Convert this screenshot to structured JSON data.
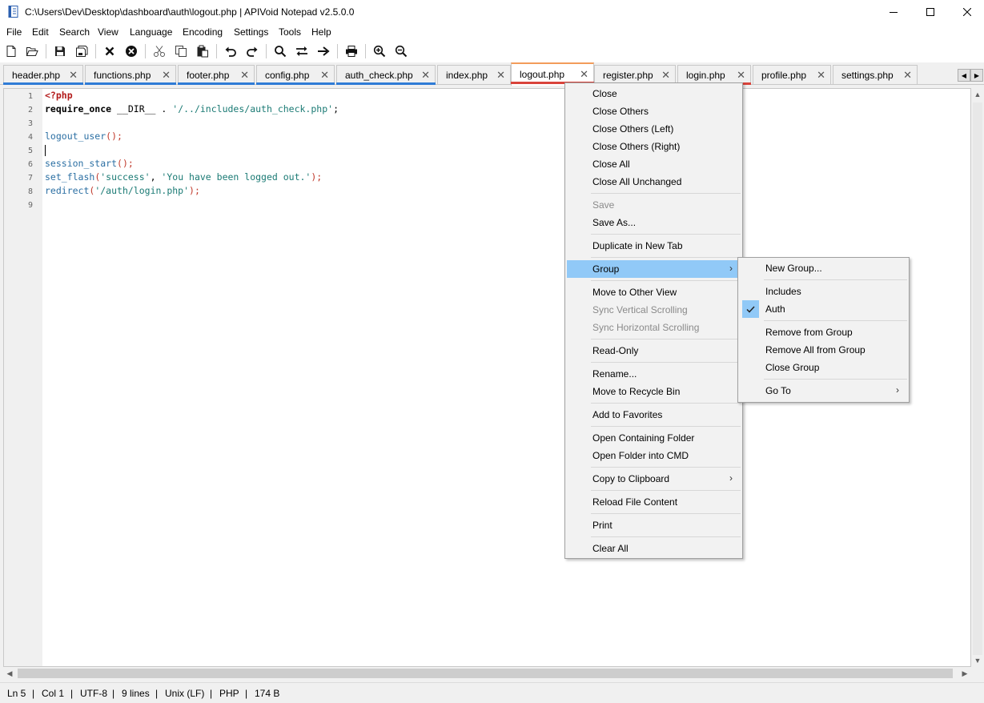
{
  "window": {
    "title": "C:\\Users\\Dev\\Desktop\\dashboard\\auth\\logout.php | APIVoid Notepad v2.5.0.0"
  },
  "menu": [
    "File",
    "Edit",
    "Search",
    "View",
    "Language",
    "Encoding",
    "Settings",
    "Tools",
    "Help"
  ],
  "toolbar_icons": [
    "new-file-icon",
    "open-file-icon",
    "save-icon",
    "save-all-icon",
    "close-icon",
    "close-all-icon",
    "cut-icon",
    "copy-icon",
    "paste-icon",
    "undo-icon",
    "redo-icon",
    "find-icon",
    "replace-icon",
    "goto-icon",
    "print-icon",
    "zoom-in-icon",
    "zoom-out-icon"
  ],
  "tabs": [
    {
      "label": "header.php",
      "color": "#2f7bd6"
    },
    {
      "label": "functions.php",
      "color": "#2f7bd6"
    },
    {
      "label": "footer.php",
      "color": "#2f7bd6"
    },
    {
      "label": "config.php",
      "color": "#2f7bd6"
    },
    {
      "label": "auth_check.php",
      "color": "#2f7bd6"
    },
    {
      "label": "index.php",
      "color": ""
    },
    {
      "label": "logout.php",
      "color": "#d9433b",
      "active": true
    },
    {
      "label": "register.php",
      "color": "#d9433b"
    },
    {
      "label": "login.php",
      "color": "#d9433b"
    },
    {
      "label": "profile.php",
      "color": ""
    },
    {
      "label": "settings.php",
      "color": ""
    }
  ],
  "editor": {
    "line_numbers": [
      "1",
      "2",
      "3",
      "4",
      "5",
      "6",
      "7",
      "8",
      "9"
    ],
    "code": {
      "l1": "<?php",
      "l2_kw": "require_once",
      "l2_mid": " __DIR__ . ",
      "l2_str": "'/../includes/auth_check.php'",
      "l2_end": ";",
      "l4_fn": "logout_user",
      "l4_end": "();",
      "l6_fn": "session_start",
      "l6_end": "();",
      "l7_fn": "set_flash",
      "l7_p1": "(",
      "l7_s1": "'success'",
      "l7_p2": ", ",
      "l7_s2": "'You have been logged out.'",
      "l7_end": ");",
      "l8_fn": "redirect",
      "l8_p1": "(",
      "l8_s1": "'/auth/login.php'",
      "l8_end": ");"
    }
  },
  "context_menu": {
    "items": [
      {
        "label": "Close",
        "enabled": true
      },
      {
        "label": "Close Others",
        "enabled": true
      },
      {
        "label": "Close Others (Left)",
        "enabled": true
      },
      {
        "label": "Close Others (Right)",
        "enabled": true
      },
      {
        "label": "Close All",
        "enabled": true
      },
      {
        "label": "Close All Unchanged",
        "enabled": true
      },
      {
        "label": "Save",
        "enabled": false
      },
      {
        "label": "Save As...",
        "enabled": true
      },
      {
        "label": "Duplicate in New Tab",
        "enabled": true
      },
      {
        "label": "Group",
        "enabled": true,
        "submenu": true,
        "highlighted": true
      },
      {
        "label": "Move to Other View",
        "enabled": true
      },
      {
        "label": "Sync Vertical Scrolling",
        "enabled": false
      },
      {
        "label": "Sync Horizontal Scrolling",
        "enabled": false
      },
      {
        "label": "Read-Only",
        "enabled": true
      },
      {
        "label": "Rename...",
        "enabled": true
      },
      {
        "label": "Move to Recycle Bin",
        "enabled": true
      },
      {
        "label": "Add to Favorites",
        "enabled": true
      },
      {
        "label": "Open Containing Folder",
        "enabled": true
      },
      {
        "label": "Open Folder into CMD",
        "enabled": true
      },
      {
        "label": "Copy to Clipboard",
        "enabled": true,
        "submenu": true
      },
      {
        "label": "Reload File Content",
        "enabled": true
      },
      {
        "label": "Print",
        "enabled": true
      },
      {
        "label": "Clear All",
        "enabled": true
      }
    ]
  },
  "group_submenu": {
    "items": [
      {
        "label": "New Group..."
      },
      {
        "label": "Includes"
      },
      {
        "label": "Auth",
        "checked": true
      },
      {
        "label": "Remove from Group"
      },
      {
        "label": "Remove All from Group"
      },
      {
        "label": "Close Group"
      },
      {
        "label": "Go To",
        "submenu": true
      }
    ]
  },
  "statusbar": {
    "line": "Ln 5",
    "col": "Col 1",
    "encoding": "UTF-8",
    "lines": "9 lines",
    "eol": "Unix (LF)",
    "language": "PHP",
    "size": "174 B"
  }
}
